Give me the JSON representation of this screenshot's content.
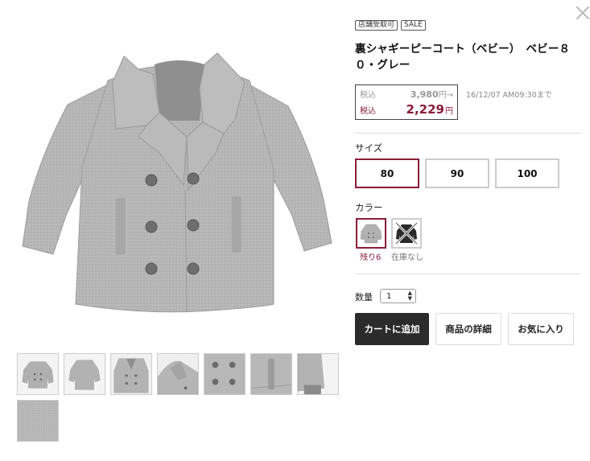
{
  "product": {
    "badges": [
      "店舗受取可",
      "SALE"
    ],
    "title": "裏シャギーピーコート（ベビー）　ベビー８０・グレー",
    "price": {
      "old_label": "税込",
      "old_value": "3,980",
      "old_unit": "円→",
      "new_label": "税込",
      "new_value": "2,229",
      "new_unit": "円",
      "sale_until": "16/12/07 AM09:30まで"
    },
    "size": {
      "label": "サイズ",
      "options": [
        "80",
        "90",
        "100"
      ],
      "selected": "80"
    },
    "color": {
      "label": "カラー",
      "options": [
        {
          "icon": "gray-coat-swatch",
          "note": "残り6",
          "selected": true
        },
        {
          "icon": "black-coat-swatch-out-of-stock",
          "note": "在庫なし",
          "selected": false
        }
      ]
    },
    "quantity": {
      "label": "数量",
      "value": "1",
      "arrow": "▲▼"
    },
    "actions": {
      "add_to_cart": "カートに追加",
      "details": "商品の詳細",
      "favorite": "お気に入り"
    }
  },
  "gallery": {
    "thumbnails": [
      "coat-front",
      "coat-back",
      "coat-front-detail",
      "coat-collar",
      "coat-buttons",
      "coat-pocket",
      "coat-sleeve",
      "coat-fabric"
    ]
  },
  "icons": {
    "close": "close-icon"
  },
  "colors": {
    "accent": "#8b1c3a",
    "coat": "#b4b4b4",
    "button_dark": "#2b2b2b"
  }
}
